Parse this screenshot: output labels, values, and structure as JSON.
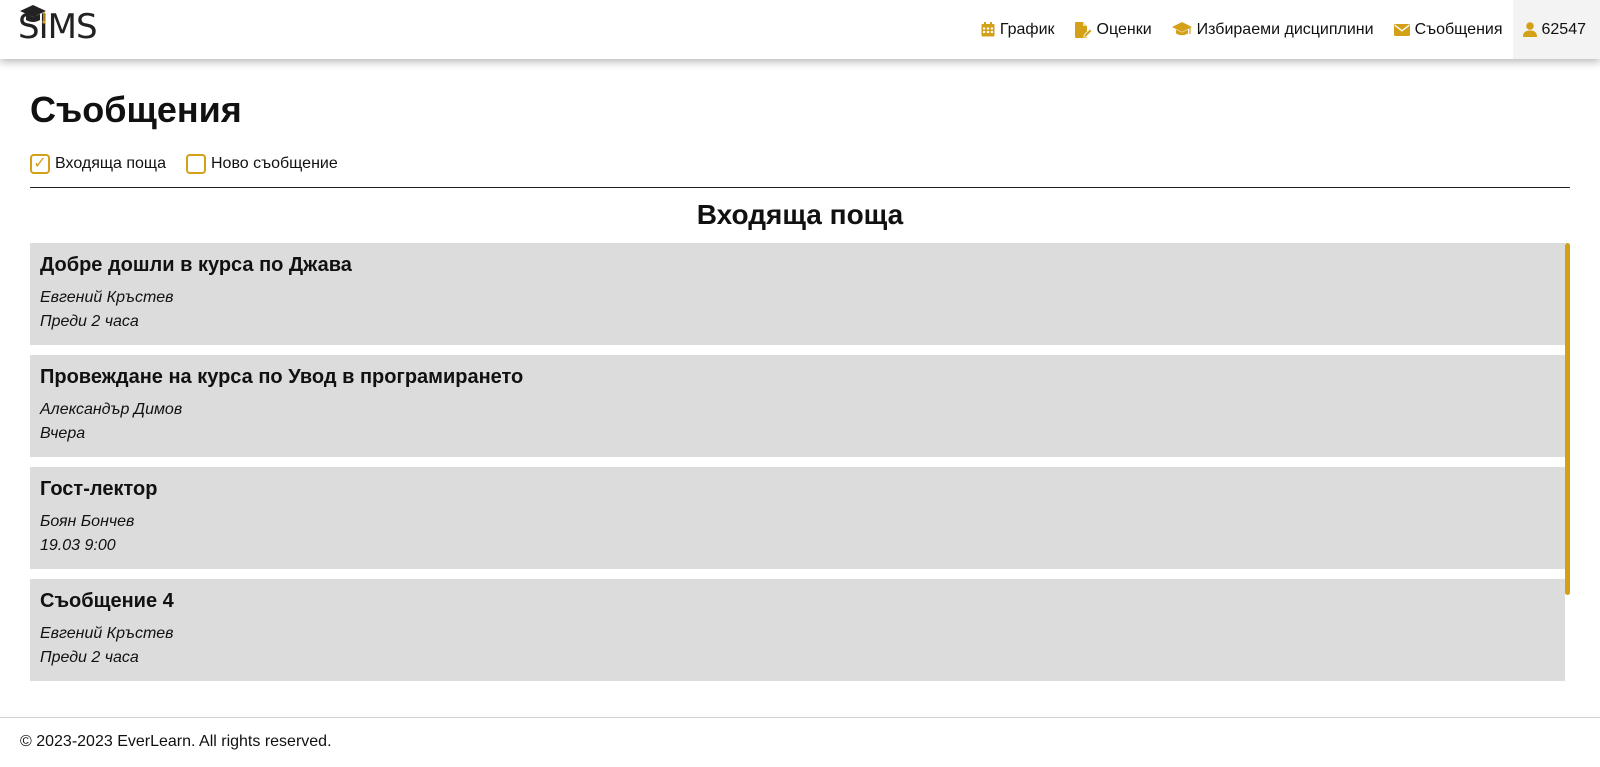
{
  "brand": {
    "logo_text": "SIMS",
    "accent_color": "#d4a017"
  },
  "nav": {
    "items": [
      {
        "label": "График",
        "icon": "calendar-icon"
      },
      {
        "label": "Оценки",
        "icon": "file-edit-icon"
      },
      {
        "label": "Избираеми дисциплини",
        "icon": "graduation-cap-icon"
      },
      {
        "label": "Съобщения",
        "icon": "envelope-icon"
      }
    ],
    "user": {
      "label": "62547",
      "icon": "user-icon"
    }
  },
  "page": {
    "title": "Съобщения"
  },
  "tabs": [
    {
      "label": "Входяща поща",
      "checked": true,
      "mark": "✓"
    },
    {
      "label": "Ново съобщение",
      "checked": false,
      "mark": ""
    }
  ],
  "inbox": {
    "title": "Входяща поща",
    "messages": [
      {
        "title": "Добре дошли в курса по Джава",
        "sender": "Евгений Кръстев",
        "time": "Преди 2 часа"
      },
      {
        "title": "Провеждане на курса по Увод в програмирането",
        "sender": "Александър Димов",
        "time": "Вчера"
      },
      {
        "title": "Гост-лектор",
        "sender": "Боян Бончев",
        "time": "19.03 9:00"
      },
      {
        "title": "Съобщение 4",
        "sender": "Евгений Кръстев",
        "time": "Преди 2 часа"
      }
    ]
  },
  "footer": {
    "text": "© 2023-2023 EverLearn. All rights reserved."
  }
}
